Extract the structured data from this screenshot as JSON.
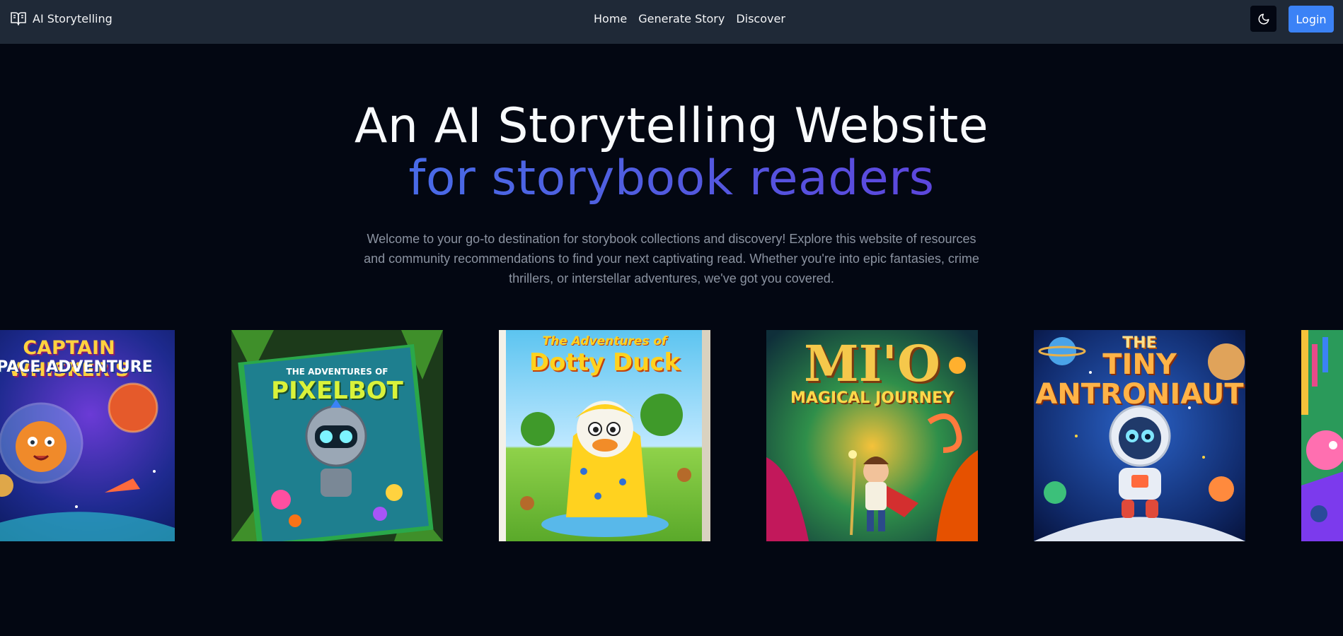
{
  "navbar": {
    "brand": "AI Storytelling",
    "links": [
      "Home",
      "Generate Story",
      "Discover"
    ],
    "login_label": "Login"
  },
  "hero": {
    "title_line1": "An AI Storytelling Website",
    "title_line2": "for storybook readers",
    "description": "Welcome to your go-to destination for storybook collections and discovery! Explore this website of resources and community recommendations to find your next captivating read. Whether you're into epic fantasies, crime thrillers, or interstellar adventures, we've got you covered."
  },
  "books": [
    {
      "title": "CAPTAIN WHISKER'S",
      "subtitle": "SPACE ADVENTURE"
    },
    {
      "title": "PIXELBOT",
      "subtitle": "THE ADVENTURES OF"
    },
    {
      "title": "Dotty Duck",
      "subtitle": "The Adventures of"
    },
    {
      "title": "MI'O",
      "subtitle": "MAGICAL JOURNEY"
    },
    {
      "title": "TINY ANTRONIAUT",
      "subtitle": "THE"
    }
  ],
  "colors": {
    "background": "#030712",
    "navbar": "#1f2937",
    "accent": "#3b82f6",
    "gradient_start": "#3b82f6",
    "gradient_end": "#6d28d9"
  }
}
